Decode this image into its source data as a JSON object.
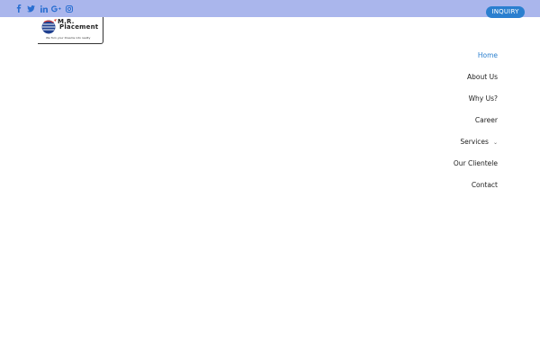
{
  "topbar": {
    "color": "#aab6ec",
    "social": [
      {
        "icon": "facebook-icon",
        "glyph": "f"
      },
      {
        "icon": "twitter-icon",
        "glyph": "t"
      },
      {
        "icon": "linkedin-icon",
        "glyph": "in"
      },
      {
        "icon": "google-plus-icon",
        "glyph": "G+"
      },
      {
        "icon": "instagram-icon",
        "glyph": "ig"
      }
    ],
    "inquiry_label": "INQUIRY",
    "inquiry_color": "#2a7fcf"
  },
  "logo": {
    "line1": "M.R.",
    "line2": "Placement",
    "tagline": "We Turn your Dreams into reality"
  },
  "nav": {
    "active_color": "#2a7fcf",
    "items": [
      {
        "label": "Home",
        "active": true
      },
      {
        "label": "About Us"
      },
      {
        "label": "Why Us?"
      },
      {
        "label": "Career"
      },
      {
        "label": "Services",
        "dropdown": true
      },
      {
        "label": "Our Clientele"
      },
      {
        "label": "Contact"
      }
    ]
  }
}
